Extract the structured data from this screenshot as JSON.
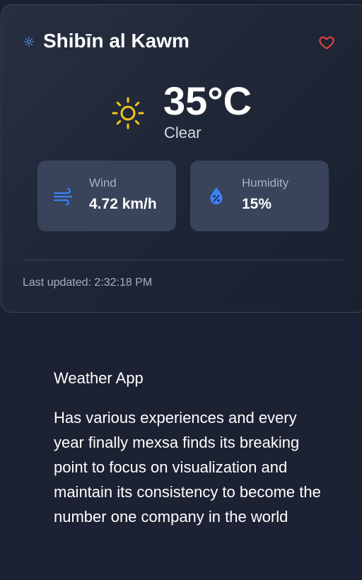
{
  "weather_card": {
    "city": "Shibīn al Kawm",
    "condition_icon": "sun-icon",
    "favorite_icon": "heart-icon",
    "temperature": "35°C",
    "condition": "Clear",
    "wind": {
      "icon": "wind-icon",
      "label": "Wind",
      "value": "4.72 km/h"
    },
    "humidity": {
      "icon": "humidity-drop-icon",
      "label": "Humidity",
      "value": "15%"
    },
    "last_updated": "Last updated: 2:32:18 PM"
  },
  "about": {
    "title": "Weather App",
    "description": "Has various experiences and every year finally mexsa finds its breaking point to focus on visualization and maintain its consistency to become the number one company in the world"
  },
  "colors": {
    "background": "#1b2131",
    "card_background": "#273041",
    "stat_background": "#39435a",
    "sun_yellow": "#f5c518",
    "small_sun_blue": "#60a5fa",
    "heart_red": "#ef4444",
    "icon_blue": "#3b82f6"
  }
}
